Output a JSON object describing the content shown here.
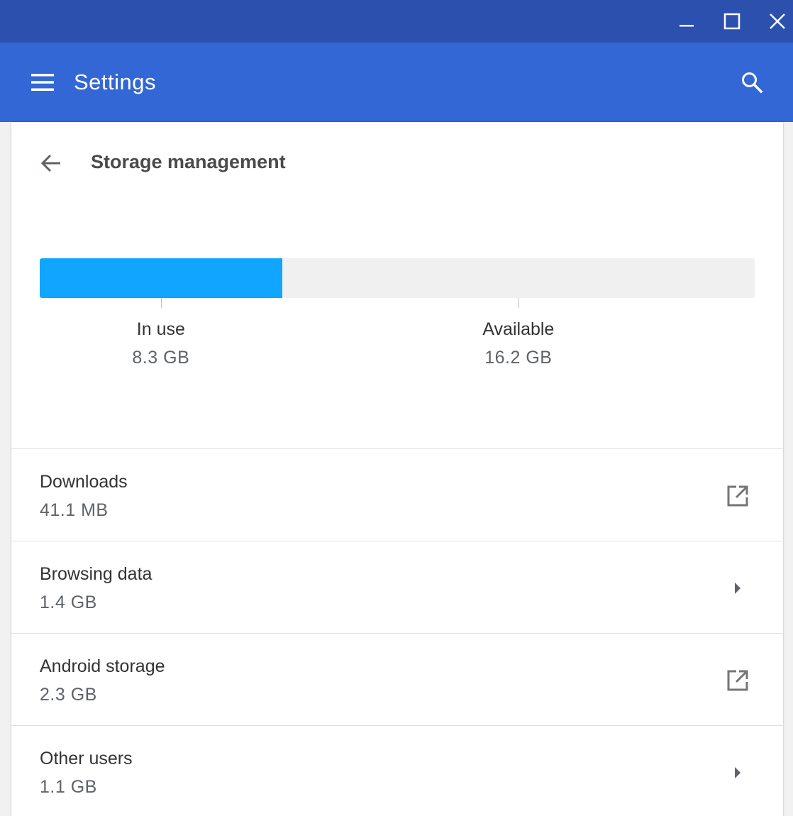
{
  "window": {
    "minimize_icon": "minimize-icon",
    "maximize_icon": "maximize-icon",
    "close_icon": "close-icon"
  },
  "appbar": {
    "title": "Settings",
    "menu_icon": "hamburger-menu-icon",
    "search_icon": "search-icon"
  },
  "page": {
    "title": "Storage management",
    "back_icon": "arrow-back-icon"
  },
  "storage": {
    "used_fraction": 0.339,
    "in_use_label": "In use",
    "in_use_value": "8.3 GB",
    "available_label": "Available",
    "available_value": "16.2 GB",
    "colors": {
      "used": "#12a5ff",
      "available": "#f0f0f0"
    }
  },
  "items": [
    {
      "label": "Downloads",
      "value": "41.1 MB",
      "icon": "open-external-icon"
    },
    {
      "label": "Browsing data",
      "value": "1.4 GB",
      "icon": "chevron-right-icon"
    },
    {
      "label": "Android storage",
      "value": "2.3 GB",
      "icon": "open-external-icon"
    },
    {
      "label": "Other users",
      "value": "1.1 GB",
      "icon": "chevron-right-icon"
    }
  ],
  "colors": {
    "titlebar": "#2c50ad",
    "appbar": "#3367d6"
  }
}
